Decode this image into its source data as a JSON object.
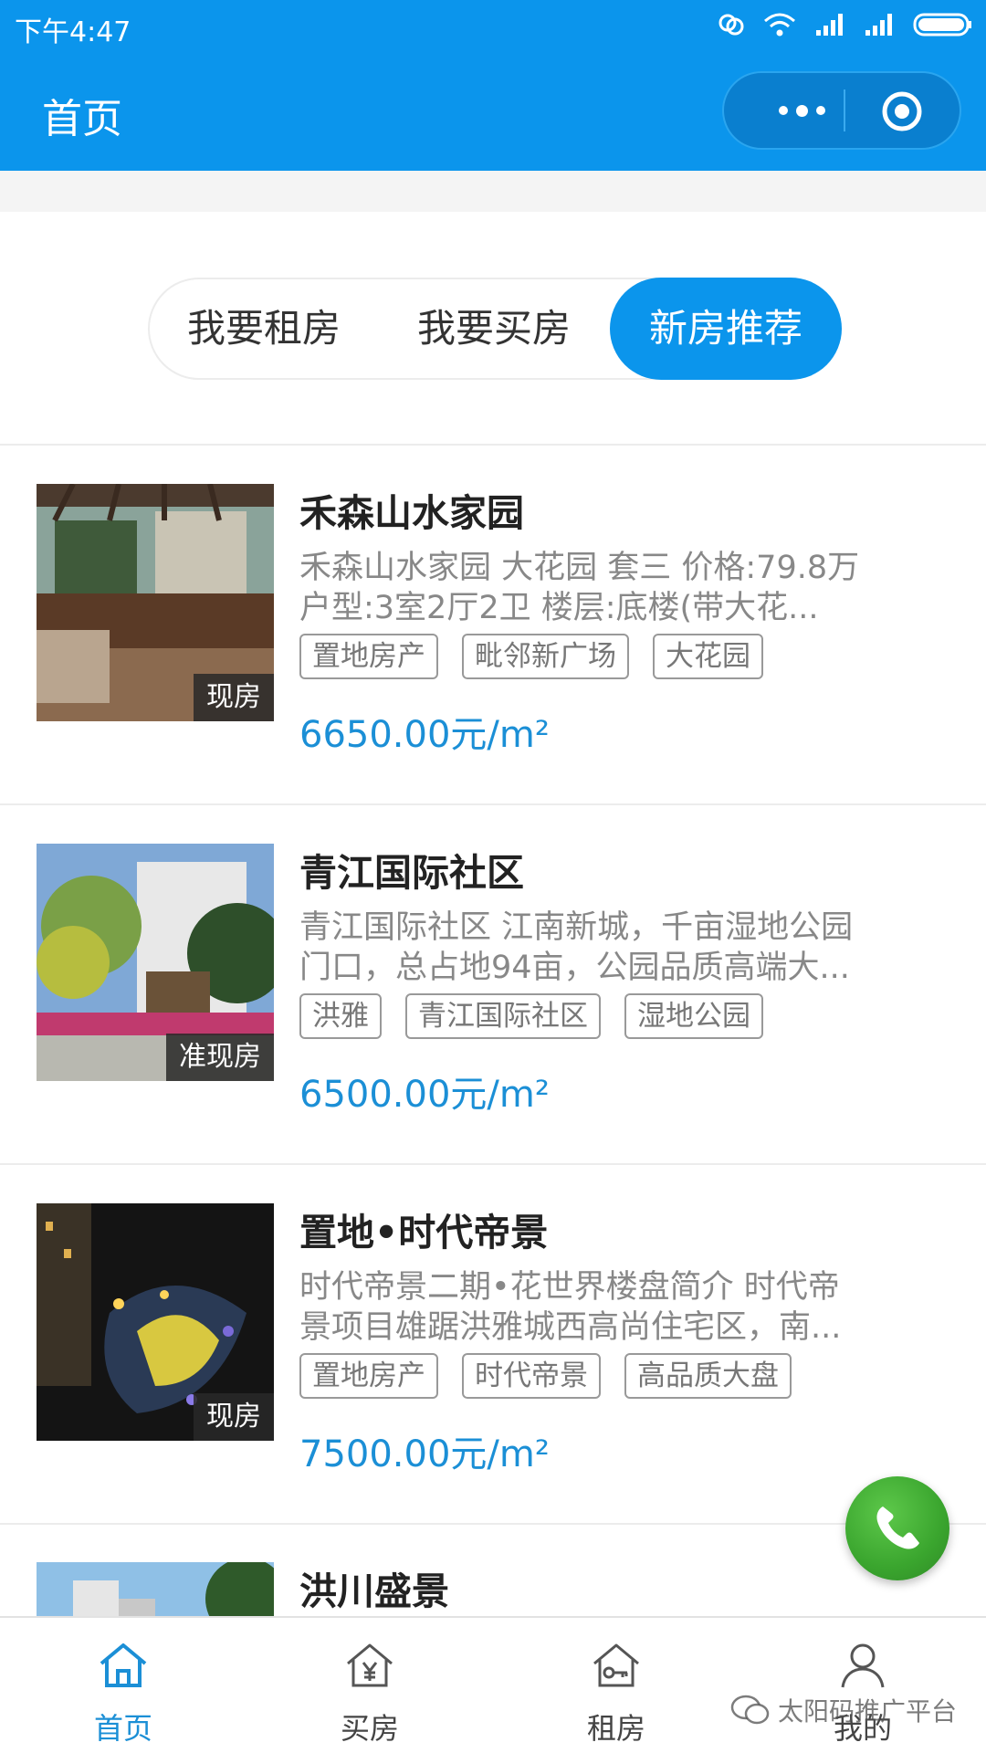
{
  "status_bar": {
    "time": "下午4:47",
    "icons": [
      "sync-icon",
      "wifi-icon",
      "signal-icon",
      "signal-icon",
      "battery-icon"
    ]
  },
  "nav": {
    "title": "首页",
    "capsule_icons": [
      "more-icon",
      "target-icon"
    ]
  },
  "tabs": [
    {
      "label": "我要租房",
      "active": false
    },
    {
      "label": "我要买房",
      "active": false
    },
    {
      "label": "新房推荐",
      "active": true
    }
  ],
  "listings": [
    {
      "title": "禾森山水家园",
      "desc_lines": [
        "禾森山水家园 大花园 套三 价格:79.8万",
        "户型:3室2厅2卫  楼层:底楼(带大花..."
      ],
      "tags": [
        "置地房产",
        "毗邻新广场",
        "大花园"
      ],
      "price": "6650.00元/m²",
      "badge": "现房"
    },
    {
      "title": "青江国际社区",
      "desc_lines": [
        "青江国际社区 江南新城，千亩湿地公园",
        "门口，总占地94亩，公园品质高端大..."
      ],
      "tags": [
        "洪雅",
        "青江国际社区",
        "湿地公园"
      ],
      "price": "6500.00元/m²",
      "badge": "准现房"
    },
    {
      "title": "置地•时代帝景",
      "desc_lines": [
        "时代帝景二期•花世界楼盘简介 时代帝",
        "景项目雄踞洪雅城西高尚住宅区，南..."
      ],
      "tags": [
        "置地房产",
        "时代帝景",
        "高品质大盘"
      ],
      "price": "7500.00元/m²",
      "badge": "现房"
    },
    {
      "title": "洪川盛景"
    }
  ],
  "fab": {
    "icon": "phone-icon"
  },
  "bottom_nav": [
    {
      "label": "首页",
      "icon": "home-icon",
      "active": true
    },
    {
      "label": "买房",
      "icon": "buy-house-icon",
      "active": false
    },
    {
      "label": "租房",
      "icon": "rent-house-icon",
      "active": false
    },
    {
      "label": "我的",
      "icon": "user-icon",
      "active": false
    }
  ],
  "watermark": "太阳码推广平台",
  "colors": {
    "primary": "#0b95ec",
    "price": "#1b8fd6",
    "fab": "#3aa52e"
  }
}
